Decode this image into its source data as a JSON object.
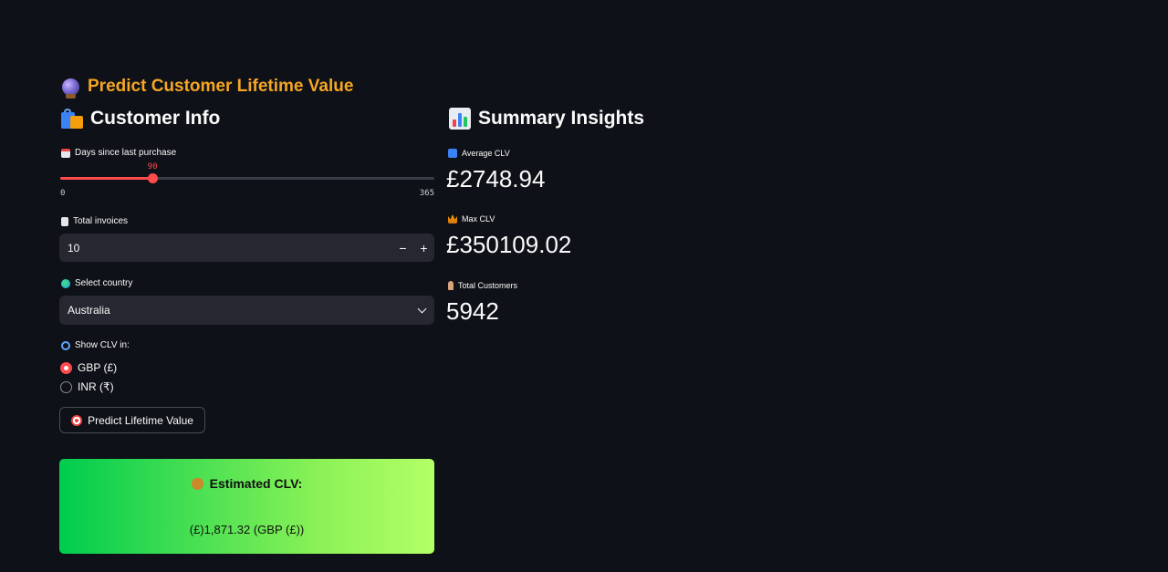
{
  "page_title": "Predict Customer Lifetime Value",
  "customer_info": {
    "header": "Customer Info",
    "days_slider": {
      "label": "Days since last purchase",
      "value": 90,
      "value_text": "90",
      "min": 0,
      "max": 365,
      "min_text": "0",
      "max_text": "365"
    },
    "invoices": {
      "label": "Total invoices",
      "value": "10",
      "minus": "−",
      "plus": "+"
    },
    "country": {
      "label": "Select country",
      "selected": "Australia"
    },
    "currency": {
      "label": "Show CLV in:",
      "options": [
        {
          "label": "GBP (£)",
          "selected": true
        },
        {
          "label": "INR (₹)",
          "selected": false
        }
      ]
    },
    "predict_button": "Predict Lifetime Value",
    "result": {
      "title": "Estimated CLV:",
      "value": "(£)1,871.32 (GBP (£))"
    }
  },
  "summary": {
    "header": "Summary Insights",
    "metrics": [
      {
        "label": "Average CLV",
        "value": "£2748.94",
        "icon": "abacus-icon"
      },
      {
        "label": "Max CLV",
        "value": "£350109.02",
        "icon": "crown-icon"
      },
      {
        "label": "Total Customers",
        "value": "5942",
        "icon": "person-icon"
      }
    ]
  },
  "colors": {
    "background": "#0e1117",
    "title_accent": "#f5a623",
    "primary": "#ff4b4b",
    "input_bg": "#262730",
    "result_gradient_start": "#00cc4e",
    "result_gradient_end": "#b3ff66"
  }
}
